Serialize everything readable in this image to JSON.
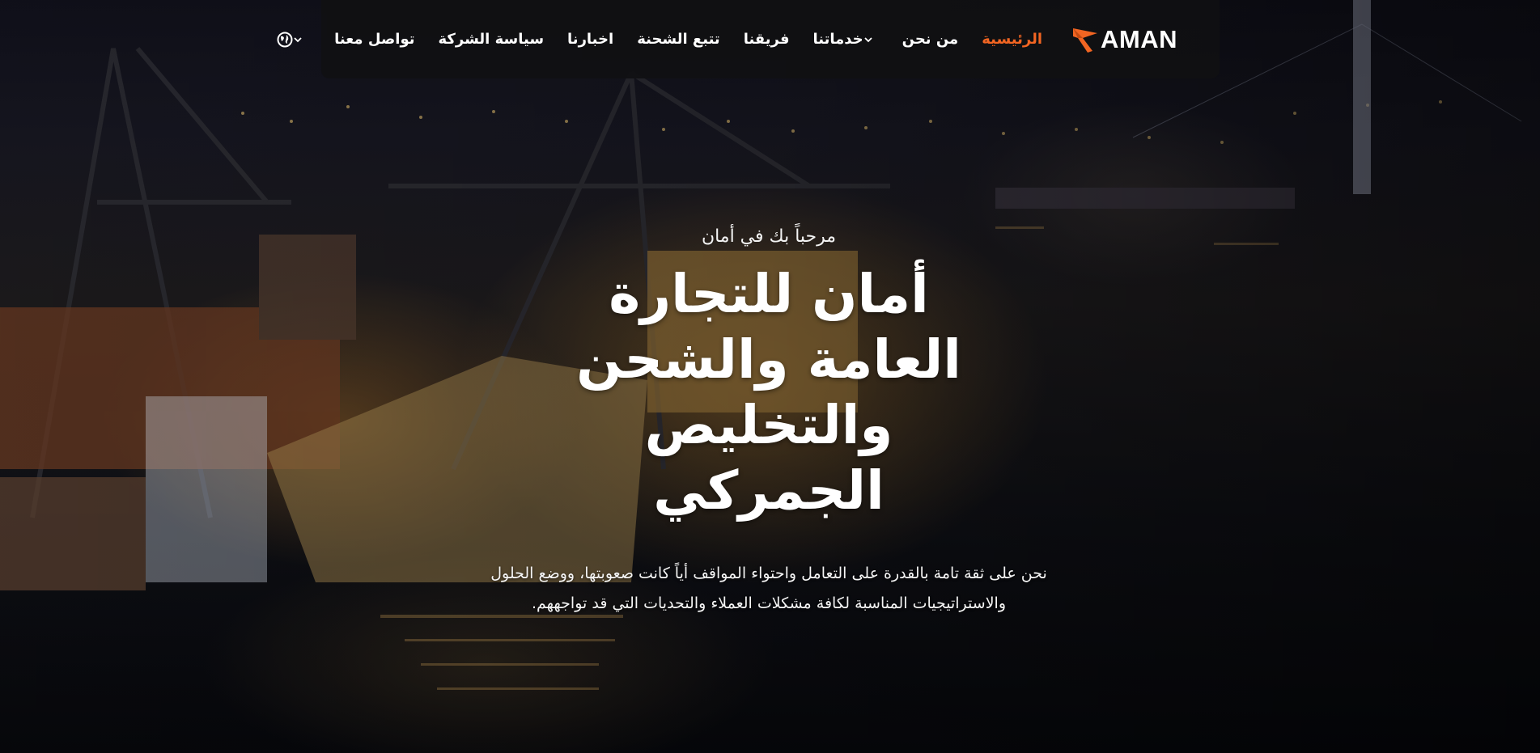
{
  "brand": {
    "name": "AMAN",
    "accent_color": "#f26522"
  },
  "nav": {
    "items": [
      {
        "label": "الرئيسية",
        "active": true,
        "has_dropdown": false
      },
      {
        "label": "من نحن",
        "active": false,
        "has_dropdown": false
      },
      {
        "label": "خدماتنا",
        "active": false,
        "has_dropdown": true
      },
      {
        "label": "فريقنا",
        "active": false,
        "has_dropdown": false
      },
      {
        "label": "تتبع الشحنة",
        "active": false,
        "has_dropdown": false
      },
      {
        "label": "اخبارنا",
        "active": false,
        "has_dropdown": false
      },
      {
        "label": "سياسة الشركة",
        "active": false,
        "has_dropdown": false
      },
      {
        "label": "تواصل معنا",
        "active": false,
        "has_dropdown": false
      }
    ],
    "language_icon": "globe-icon",
    "dropdown_icon": "chevron-down-icon"
  },
  "hero": {
    "welcome": "مرحباً بك في أمان",
    "headline": "أمان للتجارة العامة والشحن والتخليص الجمركي",
    "description": "نحن على ثقة تامة بالقدرة على التعامل واحتواء المواقف أياً كانت صعوبتها، ووضع الحلول والاستراتيجيات المناسبة لكافة مشكلات العملاء والتحديات التي قد تواجههم."
  }
}
